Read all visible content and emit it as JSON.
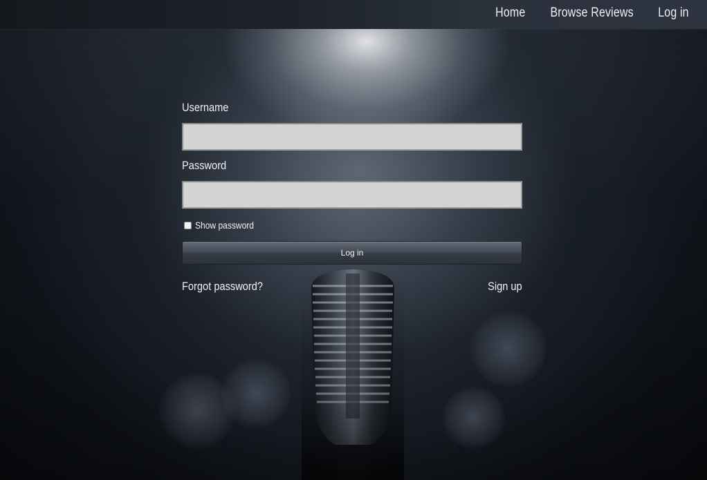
{
  "nav": {
    "links": [
      "Home",
      "Browse Reviews",
      "Log in"
    ]
  },
  "form": {
    "username_label": "Username",
    "username_value": "",
    "password_label": "Password",
    "password_value": "",
    "show_password_label": "Show password",
    "show_password_checked": false,
    "login_button": "Log in",
    "forgot_password_link": "Forgot password?",
    "sign_up_link": "Sign up"
  },
  "colors": {
    "input_background": "#d3d3d3",
    "button_gradient_top": "#626a76",
    "button_gradient_bottom": "#2d333c",
    "navbar": "#1d222a"
  },
  "background": {
    "image": "microphone-spotlight"
  }
}
